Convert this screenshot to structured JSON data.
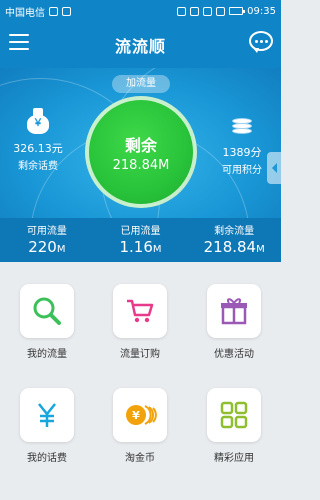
{
  "status_bar": {
    "carrier": "中国电信",
    "time": "09:35"
  },
  "header": {
    "title": "流流顺"
  },
  "hero": {
    "add_flow_label": "加流量",
    "remaining_label": "剩余",
    "remaining_value": "218.84M",
    "balance_icon": "￥",
    "balance_value": "326.13元",
    "balance_label": "剩余话费",
    "points_value": "1389分",
    "points_label": "可用积分"
  },
  "stats": [
    {
      "label": "可用流量",
      "value": "220",
      "unit": "M"
    },
    {
      "label": "已用流量",
      "value": "1.16",
      "unit": "M"
    },
    {
      "label": "剩余流量",
      "value": "218.84",
      "unit": "M"
    }
  ],
  "grid": [
    {
      "label": "我的流量",
      "icon": "magnifier-icon",
      "color": "#3cc05a"
    },
    {
      "label": "流量订购",
      "icon": "cart-icon",
      "color": "#e83a8a"
    },
    {
      "label": "优惠活动",
      "icon": "gift-icon",
      "color": "#9b59b6"
    },
    {
      "label": "我的话费",
      "icon": "yen-icon",
      "color": "#18a6dc"
    },
    {
      "label": "淘金币",
      "icon": "coins-icon",
      "color": "#f2a20b"
    },
    {
      "label": "精彩应用",
      "icon": "apps-grid-icon",
      "color": "#8fbf2e"
    }
  ],
  "colors": {
    "primary": "#0f84c7",
    "circle": "#28c33a"
  }
}
